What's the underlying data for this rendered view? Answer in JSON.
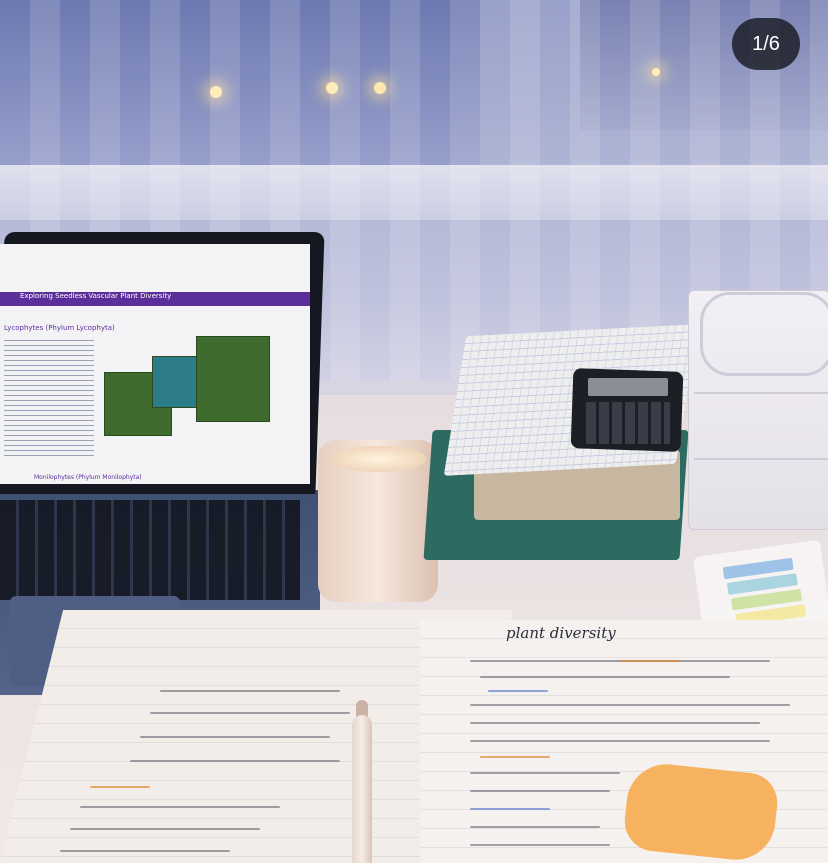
{
  "counter": {
    "text": "1/6"
  },
  "laptop": {
    "section_title": "Exploring Seedless Vascular Plant Diversity",
    "subsection_1": "Lycophytes (Phylum Lycophyta)",
    "subsection_2": "Monilophytes (Phylum Monilophyta)"
  },
  "notes": {
    "heading": "plant diversity"
  },
  "colors": {
    "accent_purple": "#5b2f99",
    "sticky_orange": "#f6b25e",
    "book_green": "#2d6b62"
  }
}
